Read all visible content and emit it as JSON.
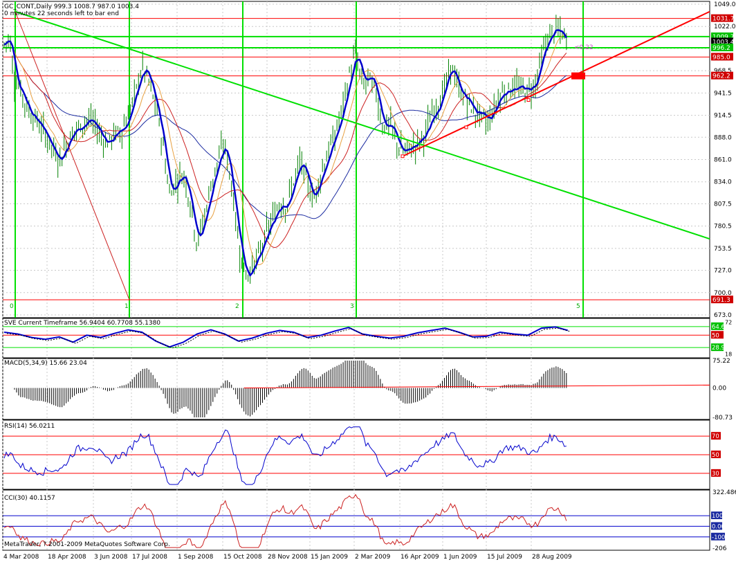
{
  "header": {
    "symbol_line": "GC_CONT,Daily  999.3 1008.7 987.0 1003.4",
    "timer_line": "0 minutes 22 seconds left to bar end"
  },
  "footer": {
    "copyright": "MetaTrader, ? 2001-2009 MetaQuotes Software Corp."
  },
  "colors": {
    "background": "#ffffff",
    "candle": "#008000",
    "fast_ma": "#0000cc",
    "grid": "#c8c8c8",
    "green_lines": "#00e000",
    "red_lines": "#ff0000",
    "ma_orange": "#e8a040",
    "ma_red": "#cc2020",
    "ma_navy": "#1a2aa0"
  },
  "chart_data": [
    {
      "type": "candlestick",
      "panel": "main",
      "ylim": [
        673.0,
        1049.0
      ],
      "y_ticks": [
        "1049.0",
        "1022.0",
        "995.3",
        "968.5",
        "941.5",
        "914.5",
        "888.0",
        "861.0",
        "834.0",
        "807.5",
        "780.5",
        "753.5",
        "727.0",
        "700.0",
        "673.0"
      ],
      "x_ticks": [
        "4 Mar 2008",
        "18 Apr 2008",
        "3 Jun 2008",
        "17 Jul 2008",
        "1 Sep 2008",
        "15 Oct 2008",
        "28 Nov 2008",
        "15 Jan 2009",
        "2 Mar 2009",
        "16 Apr 2009",
        "1 Jun 2009",
        "15 Jul 2009",
        "28 Aug 2009"
      ],
      "last_price": "1003.4",
      "price_labels": [
        {
          "text": "1031.7",
          "color": "red",
          "value": 1031.7
        },
        {
          "text": "1009.7",
          "color": "green",
          "value": 1009.7
        },
        {
          "text": "1003.4",
          "color": "black",
          "value": 1003.4
        },
        {
          "text": "996.2",
          "color": "green",
          "value": 996.2
        },
        {
          "text": "985.0",
          "color": "red",
          "value": 985.0
        },
        {
          "text": "962.2",
          "color": "red",
          "value": 962.2
        },
        {
          "text": "691.3",
          "color": "red",
          "value": 691.3
        }
      ],
      "horizontal_lines": [
        1031.7,
        1009.7,
        996.2,
        985.0,
        962.2,
        691.3
      ],
      "wave_labels": [
        "0",
        "1",
        "2",
        "3",
        "5"
      ],
      "annotation": "<0.22",
      "close_path": [
        [
          0,
          1000
        ],
        [
          8,
          1010
        ],
        [
          14,
          960
        ],
        [
          22,
          950
        ],
        [
          30,
          930
        ],
        [
          40,
          915
        ],
        [
          50,
          905
        ],
        [
          60,
          890
        ],
        [
          70,
          875
        ],
        [
          80,
          860
        ],
        [
          90,
          880
        ],
        [
          100,
          895
        ],
        [
          110,
          900
        ],
        [
          120,
          910
        ],
        [
          130,
          905
        ],
        [
          140,
          890
        ],
        [
          150,
          880
        ],
        [
          160,
          892
        ],
        [
          170,
          895
        ],
        [
          180,
          915
        ],
        [
          190,
          940
        ],
        [
          200,
          975
        ],
        [
          210,
          955
        ],
        [
          220,
          925
        ],
        [
          230,
          880
        ],
        [
          240,
          820
        ],
        [
          250,
          835
        ],
        [
          260,
          845
        ],
        [
          270,
          810
        ],
        [
          280,
          760
        ],
        [
          290,
          790
        ],
        [
          300,
          830
        ],
        [
          310,
          860
        ],
        [
          320,
          880
        ],
        [
          330,
          830
        ],
        [
          340,
          760
        ],
        [
          350,
          720
        ],
        [
          360,
          730
        ],
        [
          370,
          745
        ],
        [
          380,
          770
        ],
        [
          390,
          790
        ],
        [
          400,
          810
        ],
        [
          410,
          805
        ],
        [
          420,
          835
        ],
        [
          430,
          860
        ],
        [
          440,
          830
        ],
        [
          450,
          815
        ],
        [
          460,
          845
        ],
        [
          470,
          870
        ],
        [
          480,
          890
        ],
        [
          490,
          920
        ],
        [
          500,
          960
        ],
        [
          510,
          990
        ],
        [
          520,
          950
        ],
        [
          530,
          960
        ],
        [
          540,
          940
        ],
        [
          550,
          900
        ],
        [
          560,
          905
        ],
        [
          570,
          880
        ],
        [
          580,
          870
        ],
        [
          590,
          875
        ],
        [
          600,
          880
        ],
        [
          610,
          890
        ],
        [
          620,
          915
        ],
        [
          630,
          930
        ],
        [
          640,
          950
        ],
        [
          650,
          975
        ],
        [
          660,
          945
        ],
        [
          670,
          935
        ],
        [
          680,
          920
        ],
        [
          690,
          915
        ],
        [
          700,
          905
        ],
        [
          710,
          920
        ],
        [
          720,
          940
        ],
        [
          730,
          945
        ],
        [
          740,
          950
        ],
        [
          750,
          945
        ],
        [
          760,
          945
        ],
        [
          770,
          950
        ],
        [
          780,
          985
        ],
        [
          790,
          1010
        ],
        [
          800,
          1018
        ],
        [
          810,
          1012
        ],
        [
          818,
          1003.4
        ]
      ]
    },
    {
      "type": "line",
      "panel": "sve",
      "title": "SVE Current Timeframe 56.9404 60.7708 55.1380",
      "y_labels": [
        "64.6",
        "50",
        "28.9"
      ],
      "side_values": [
        "72",
        "18"
      ],
      "series": [
        {
          "values": [
            [
              0,
              55
            ],
            [
              20,
              52
            ],
            [
              40,
              46
            ],
            [
              60,
              43
            ],
            [
              80,
              47
            ],
            [
              100,
              38
            ],
            [
              120,
              50
            ],
            [
              140,
              46
            ],
            [
              160,
              53
            ],
            [
              180,
              59
            ],
            [
              200,
              55
            ],
            [
              220,
              40
            ],
            [
              240,
              30
            ],
            [
              260,
              38
            ],
            [
              280,
              52
            ],
            [
              300,
              59
            ],
            [
              320,
              52
            ],
            [
              340,
              40
            ],
            [
              360,
              45
            ],
            [
              380,
              53
            ],
            [
              400,
              58
            ],
            [
              420,
              55
            ],
            [
              440,
              46
            ],
            [
              460,
              50
            ],
            [
              480,
              57
            ],
            [
              500,
              63
            ],
            [
              520,
              52
            ],
            [
              540,
              48
            ],
            [
              560,
              45
            ],
            [
              580,
              48
            ],
            [
              600,
              54
            ],
            [
              620,
              58
            ],
            [
              640,
              62
            ],
            [
              660,
              55
            ],
            [
              680,
              47
            ],
            [
              700,
              48
            ],
            [
              720,
              55
            ],
            [
              740,
              52
            ],
            [
              760,
              50
            ],
            [
              780,
              62
            ],
            [
              800,
              64
            ],
            [
              818,
              58
            ]
          ]
        }
      ]
    },
    {
      "type": "bar",
      "panel": "macd",
      "title": "MACD(5,34,9) 15.66 23.04",
      "y_labels": [
        "75.22",
        "0.00",
        "-80.73"
      ],
      "ylim": [
        -80.73,
        75.22
      ]
    },
    {
      "type": "line",
      "panel": "rsi",
      "title": "RSI(14) 56.0211",
      "y_labels": [
        "70",
        "50",
        "30"
      ],
      "ylim": [
        15,
        85
      ]
    },
    {
      "type": "line",
      "panel": "cci",
      "title": "CCI(30) 40.1157",
      "y_labels": [
        "322.486",
        "100",
        "0.00",
        "-100",
        "-206"
      ],
      "ylim": [
        -206,
        322.486
      ]
    }
  ]
}
